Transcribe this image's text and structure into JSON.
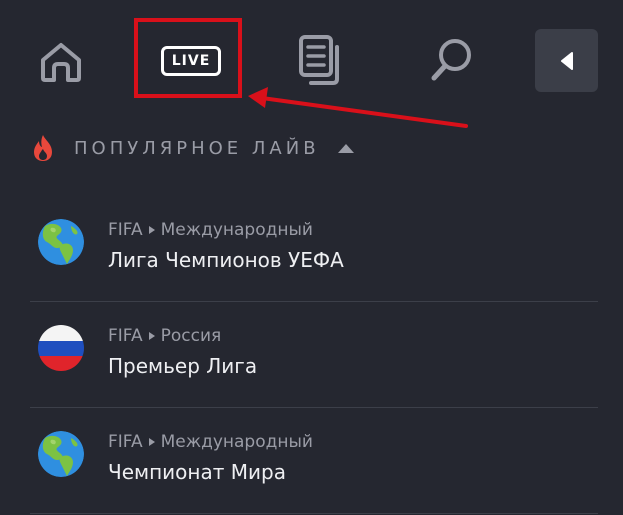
{
  "nav": {
    "home_icon": "home-icon",
    "live_label": "LIVE",
    "bets_icon": "document-stack-icon",
    "search_icon": "search-icon",
    "back_icon": "caret-left-icon"
  },
  "colors": {
    "background": "#252730",
    "highlight": "#d9101a",
    "muted_text": "#9a9ca6",
    "fire": "#e8483c"
  },
  "section": {
    "icon": "fire-icon",
    "title": "ПОПУЛЯРНОЕ ЛАЙВ",
    "toggle_icon": "caret-up-icon"
  },
  "leagues": [
    {
      "category": "FIFA",
      "region": "Международный",
      "name": "Лига Чемпионов УЕФА",
      "flag": "globe-icon"
    },
    {
      "category": "FIFA",
      "region": "Россия",
      "name": "Премьер Лига",
      "flag": "russia-flag-icon"
    },
    {
      "category": "FIFA",
      "region": "Международный",
      "name": "Чемпионат Мира",
      "flag": "globe-icon"
    }
  ]
}
